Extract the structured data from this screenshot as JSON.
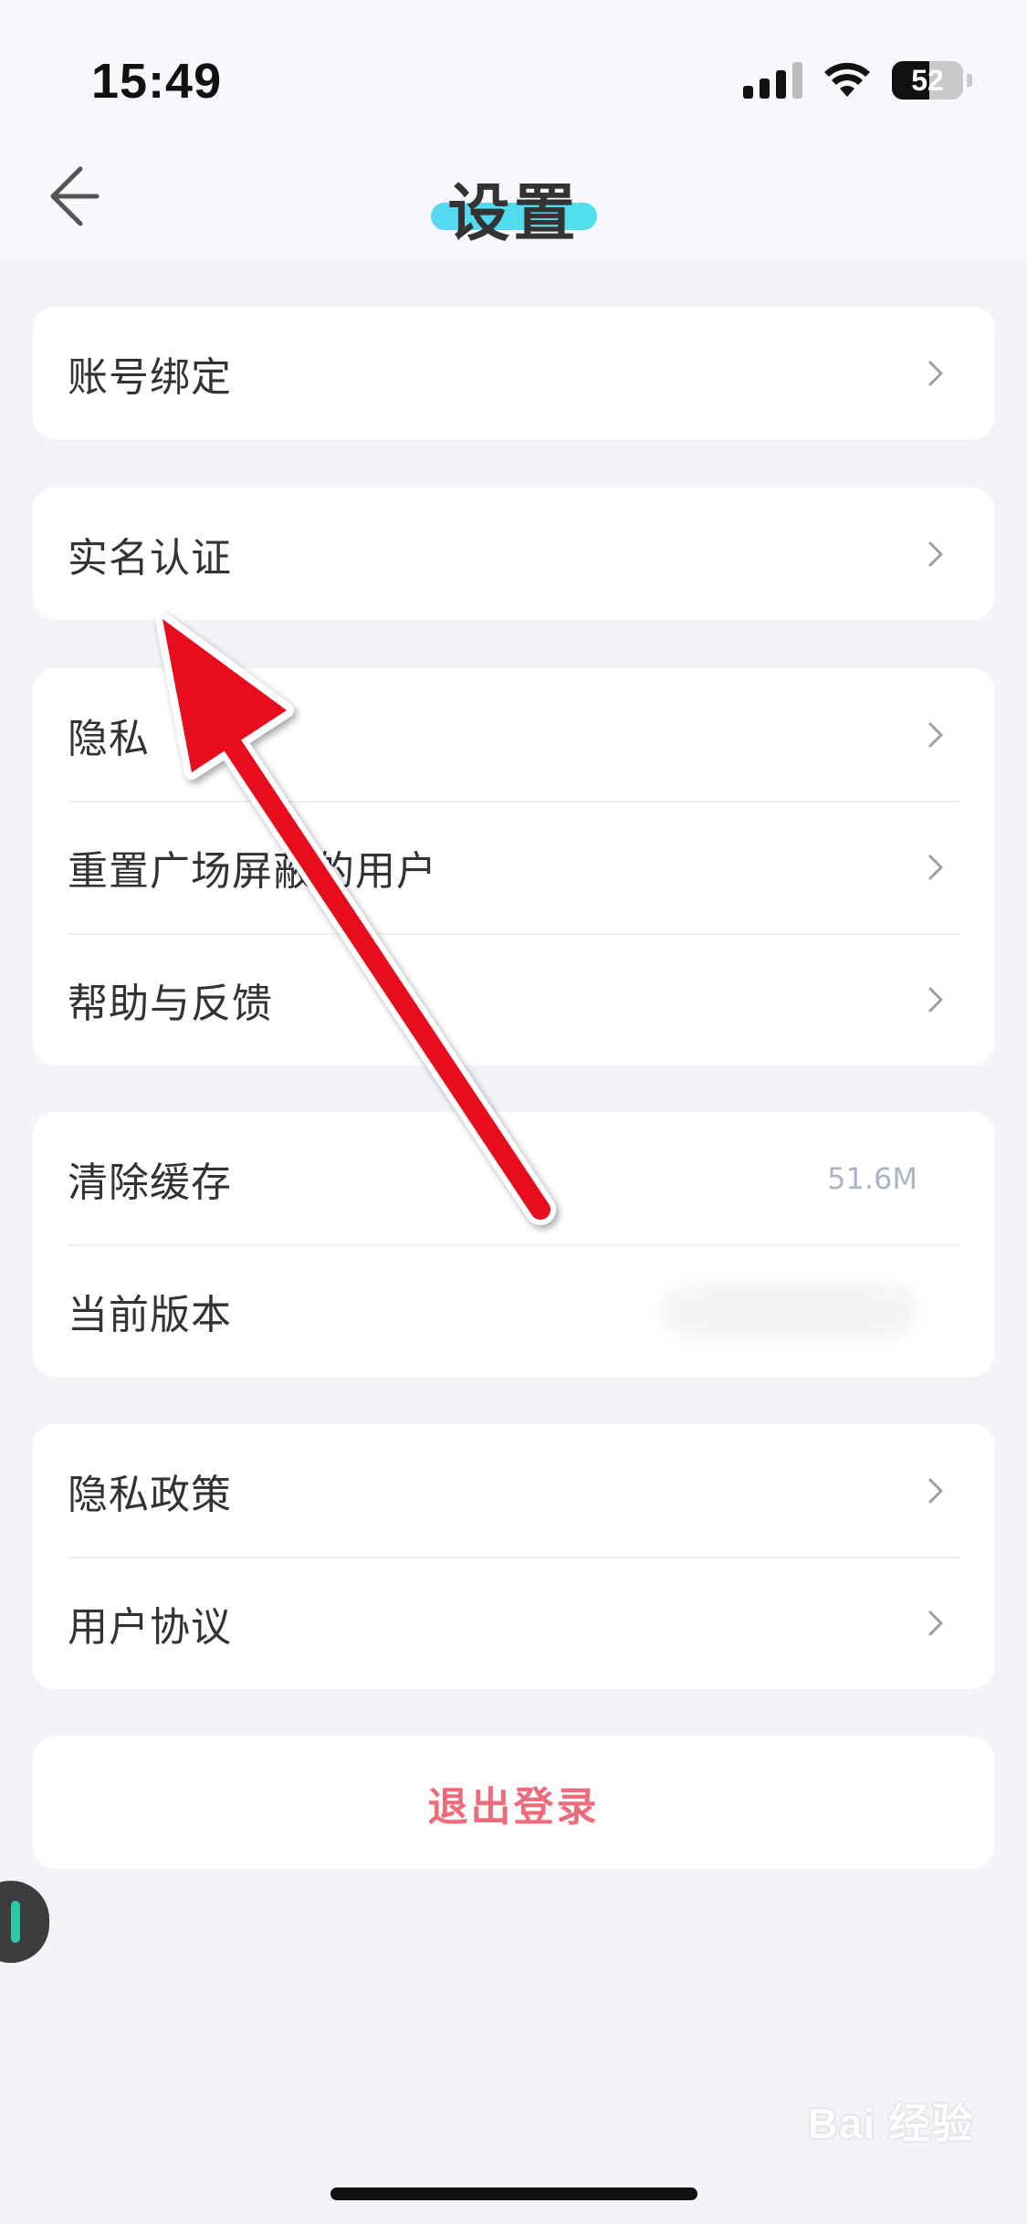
{
  "status_bar": {
    "time": "15:49",
    "battery": "52",
    "battery_level": 0.52
  },
  "nav": {
    "title": "设置",
    "back_icon": "back-arrow-icon"
  },
  "groups": [
    {
      "rows": [
        {
          "label": "账号绑定"
        }
      ]
    },
    {
      "rows": [
        {
          "label": "实名认证"
        }
      ]
    },
    {
      "rows": [
        {
          "label": "隐私"
        },
        {
          "label": "重置广场屏蔽的用户"
        },
        {
          "label": "帮助与反馈"
        }
      ]
    },
    {
      "rows": [
        {
          "label": "清除缓存",
          "value": "51.6M"
        },
        {
          "label": "当前版本"
        }
      ]
    },
    {
      "rows": [
        {
          "label": "隐私政策"
        },
        {
          "label": "用户协议"
        }
      ]
    }
  ],
  "logout": {
    "label": "退出登录"
  },
  "watermark": {
    "text": "Bai 经验"
  },
  "colors": {
    "background": "#f3f4f8",
    "title_highlight": "#56d8f4",
    "logout": "#ef6b7b",
    "annotation_arrow": "#e8101a"
  }
}
